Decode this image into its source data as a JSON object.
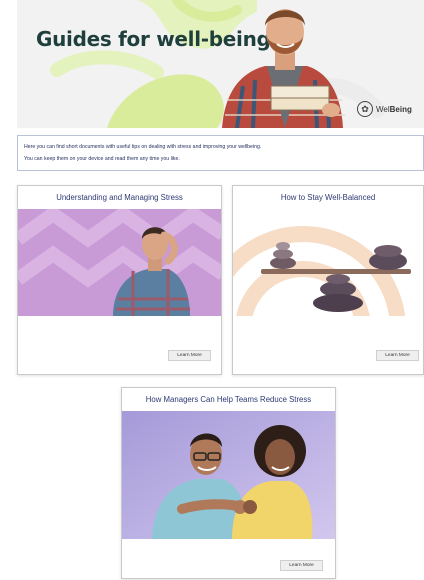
{
  "banner": {
    "title": "Guides for well-being",
    "logo_text_prefix": "Wel",
    "logo_text_bold": "Being"
  },
  "intro": {
    "line1": "Here you can find short documents with useful tips on dealing with stress and improving your wellbeing.",
    "line2": "You can keep them on your device and read them any time you like."
  },
  "cards": [
    {
      "title": "Understanding and Managing Stress",
      "button": "Learn More"
    },
    {
      "title": "How to Stay Well-Balanced",
      "button": "Learn More"
    },
    {
      "title": "How Managers Can Help Teams Reduce Stress",
      "button": "Learn More"
    }
  ],
  "colors": {
    "title": "#1f3f3d",
    "accent_green": "#d8ec9c",
    "card_title": "#2e3a73",
    "purple_bg": "#c89ad6",
    "peach": "#f7dcc6"
  }
}
